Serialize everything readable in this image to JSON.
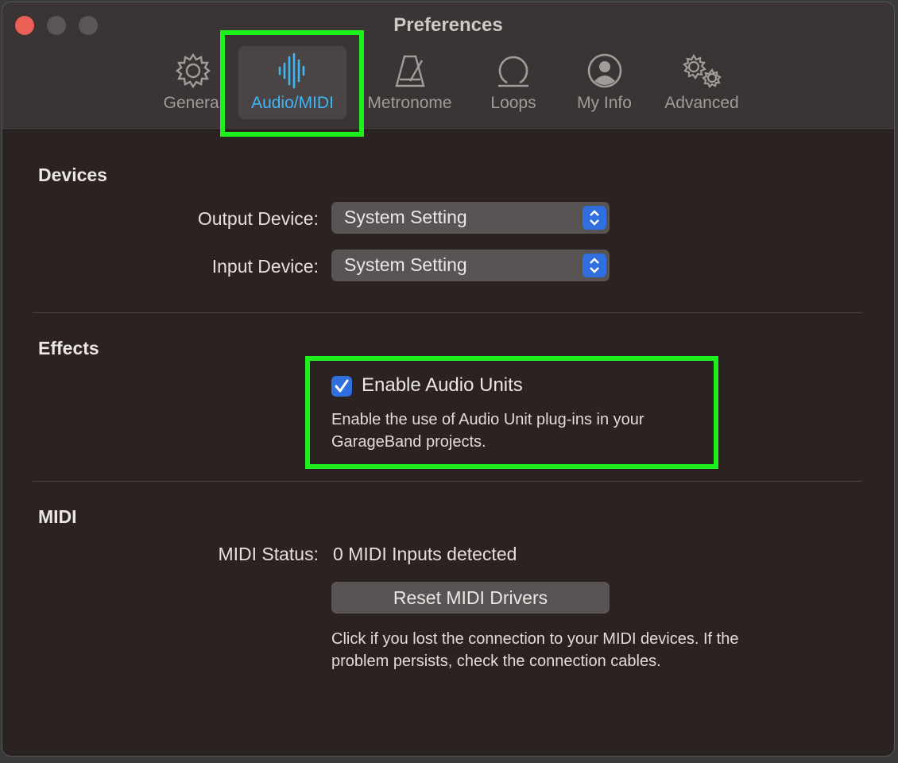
{
  "window": {
    "title": "Preferences"
  },
  "toolbar": {
    "tabs": [
      {
        "label": "General",
        "icon": "gear-icon"
      },
      {
        "label": "Audio/MIDI",
        "icon": "waveform-icon",
        "selected": true
      },
      {
        "label": "Metronome",
        "icon": "metronome-icon"
      },
      {
        "label": "Loops",
        "icon": "loop-icon"
      },
      {
        "label": "My Info",
        "icon": "person-icon"
      },
      {
        "label": "Advanced",
        "icon": "gears-icon"
      }
    ]
  },
  "devices": {
    "title": "Devices",
    "output_label": "Output Device:",
    "output_value": "System Setting",
    "input_label": "Input Device:",
    "input_value": "System Setting"
  },
  "effects": {
    "title": "Effects",
    "checkbox_label": "Enable Audio Units",
    "checked": true,
    "description_line1": "Enable the use of Audio Unit plug-ins in your",
    "description_line2": "GarageBand projects."
  },
  "midi": {
    "title": "MIDI",
    "status_label": "MIDI Status:",
    "status_value": "0 MIDI Inputs detected",
    "reset_button": "Reset MIDI Drivers",
    "note_line1": "Click if you lost the connection to your MIDI devices. If the",
    "note_line2": "problem persists, check the connection cables."
  },
  "colors": {
    "accent_selected": "#3fb7f5",
    "highlight": "#1ef01e",
    "control_blue": "#2f6fe0"
  }
}
